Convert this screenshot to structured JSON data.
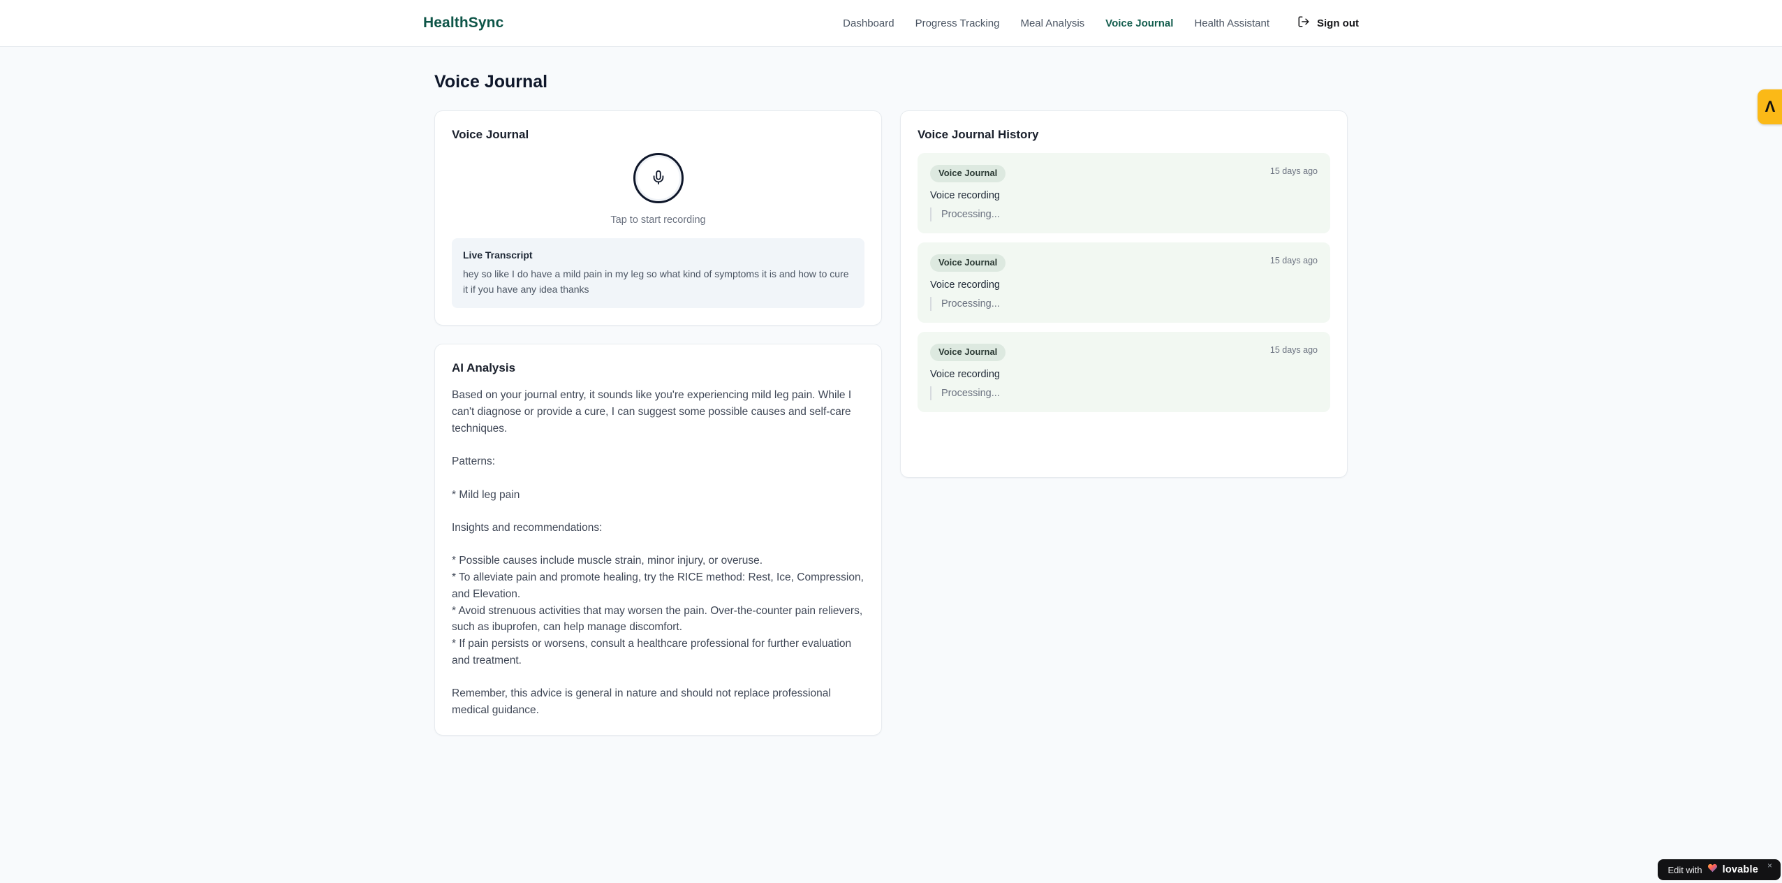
{
  "brand": {
    "name": "HealthSync",
    "color": "#0e5548"
  },
  "nav": {
    "items": [
      {
        "label": "Dashboard",
        "active": false
      },
      {
        "label": "Progress Tracking",
        "active": false
      },
      {
        "label": "Meal Analysis",
        "active": false
      },
      {
        "label": "Voice Journal",
        "active": true
      },
      {
        "label": "Health Assistant",
        "active": false
      }
    ],
    "sign_out_label": "Sign out"
  },
  "page": {
    "title": "Voice Journal"
  },
  "recorder_card": {
    "title": "Voice Journal",
    "tap_hint": "Tap to start recording",
    "transcript_label": "Live Transcript",
    "transcript_text": "hey so like I do have a mild pain in my leg so what kind of symptoms it is and how to cure it if you have any idea thanks"
  },
  "analysis_card": {
    "title": "AI Analysis",
    "body": "Based on your journal entry, it sounds like you're experiencing mild leg pain. While I can't diagnose or provide a cure, I can suggest some possible causes and self-care techniques.\n\nPatterns:\n\n* Mild leg pain\n\nInsights and recommendations:\n\n* Possible causes include muscle strain, minor injury, or overuse.\n* To alleviate pain and promote healing, try the RICE method: Rest, Ice, Compression, and Elevation.\n* Avoid strenuous activities that may worsen the pain. Over-the-counter pain relievers, such as ibuprofen, can help manage discomfort.\n* If pain persists or worsens, consult a healthcare professional for further evaluation and treatment.\n\nRemember, this advice is general in nature and should not replace professional medical guidance."
  },
  "history_card": {
    "title": "Voice Journal History",
    "entries": [
      {
        "badge": "Voice Journal",
        "time": "15 days ago",
        "label": "Voice recording",
        "status": "Processing..."
      },
      {
        "badge": "Voice Journal",
        "time": "15 days ago",
        "label": "Voice recording",
        "status": "Processing..."
      },
      {
        "badge": "Voice Journal",
        "time": "15 days ago",
        "label": "Voice recording",
        "status": "Processing..."
      }
    ]
  },
  "overlays": {
    "side_button_glyph": "Λ",
    "lovable_prefix": "Edit with",
    "lovable_brand": "lovable",
    "lovable_close": "×"
  },
  "colors": {
    "brand_green": "#0e5548",
    "active_nav": "#155e4f",
    "page_bg": "#f8fafc",
    "history_entry_bg": "#f2f8f2",
    "history_badge_bg": "#dde9e0",
    "side_button_amber": "#fbb917",
    "lovable_bg": "#121214"
  }
}
